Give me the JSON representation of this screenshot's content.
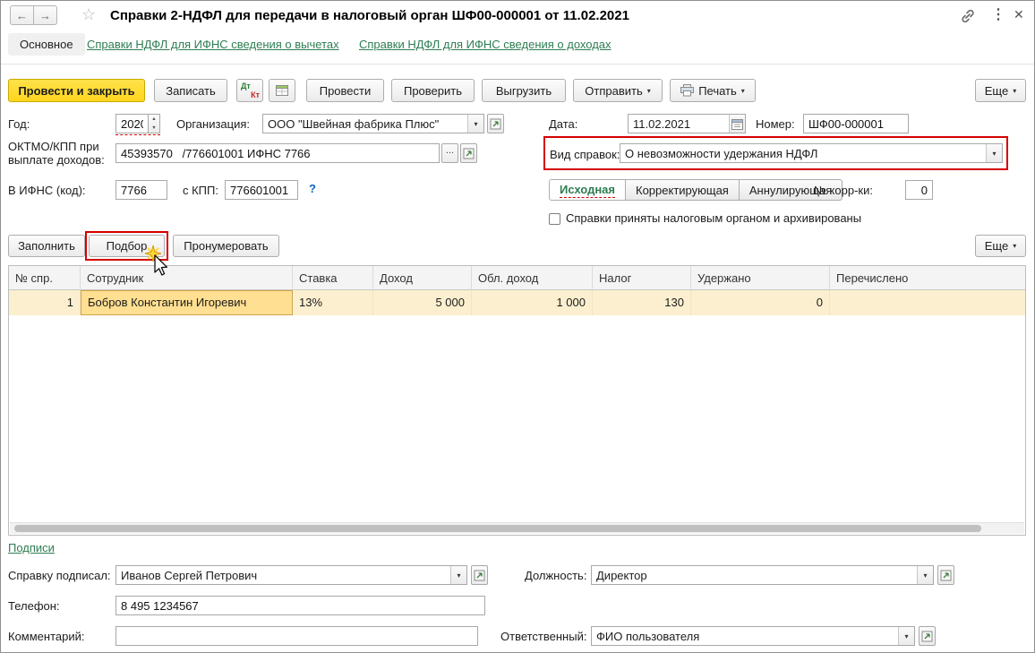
{
  "window": {
    "title": "Справки 2-НДФЛ для передачи в налоговый орган ШФ00-000001 от 11.02.2021"
  },
  "icons": {
    "back": "←",
    "forward": "→",
    "star": "☆",
    "dots": "⋮",
    "close": "✕",
    "dropdown": "▾",
    "ellipsis": "...",
    "up": "▲",
    "down": "▼",
    "help": "?",
    "dt": "Дт",
    "kt": "Кт"
  },
  "colors": {
    "primary_button": "#ffd51e",
    "annotation_red": "#d40000",
    "row_selection": "#fcefcf",
    "cell_selection": "#ffdf91",
    "link_green": "#2e7d52"
  },
  "nav": {
    "main_tab": "Основное",
    "link_deductions": "Справки НДФЛ для ИФНС сведения о вычетах",
    "link_incomes": "Справки НДФЛ для ИФНС сведения о доходах"
  },
  "toolbar": {
    "post_close": "Провести и закрыть",
    "save": "Записать",
    "post": "Провести",
    "check": "Проверить",
    "export": "Выгрузить",
    "send": "Отправить",
    "print": "Печать",
    "more": "Еще"
  },
  "form": {
    "year_label": "Год:",
    "year_value": "2020",
    "org_label": "Организация:",
    "org_value": "ООО \"Швейная фабрика Плюс\"",
    "date_label": "Дата:",
    "date_value": "11.02.2021",
    "number_label": "Номер:",
    "number_value": "ШФ00-000001",
    "oktmo_label": "ОКТМО/КПП при выплате доходов:",
    "oktmo_value": "45393570   /776601001 ИФНС 7766",
    "kind_label": "Вид справок:",
    "kind_value": "О невозможности удержания НДФЛ",
    "ifns_label": "В ИФНС (код):",
    "ifns_value": "7766",
    "kpp_label": "с КПП:",
    "kpp_value": "776601001",
    "type_original": "Исходная",
    "type_correcting": "Корректирующая",
    "type_cancelling": "Аннулирующая",
    "corr_label": "№ корр-ки:",
    "corr_value": "0",
    "archived_label": "Справки приняты налоговым органом и архивированы"
  },
  "tablebar": {
    "fill": "Заполнить",
    "pick": "Подбор",
    "renumber": "Пронумеровать",
    "more": "Еще"
  },
  "table": {
    "columns": [
      "№ спр.",
      "Сотрудник",
      "Ставка",
      "Доход",
      "Обл. доход",
      "Налог",
      "Удержано",
      "Перечислено"
    ],
    "rows": [
      {
        "no": "1",
        "employee": "Бобров Константин Игоревич",
        "rate": "13%",
        "income": "5 000",
        "taxable": "1 000",
        "tax": "130",
        "withheld": "0",
        "transferred": ""
      }
    ]
  },
  "footer": {
    "signs": "Подписи",
    "signed_label": "Справку подписал:",
    "signed_value": "Иванов Сергей Петрович",
    "position_label": "Должность:",
    "position_value": "Директор",
    "phone_label": "Телефон:",
    "phone_value": "8 495 1234567",
    "comment_label": "Комментарий:",
    "comment_value": "",
    "responsible_label": "Ответственный:",
    "responsible_value": "ФИО пользователя"
  }
}
